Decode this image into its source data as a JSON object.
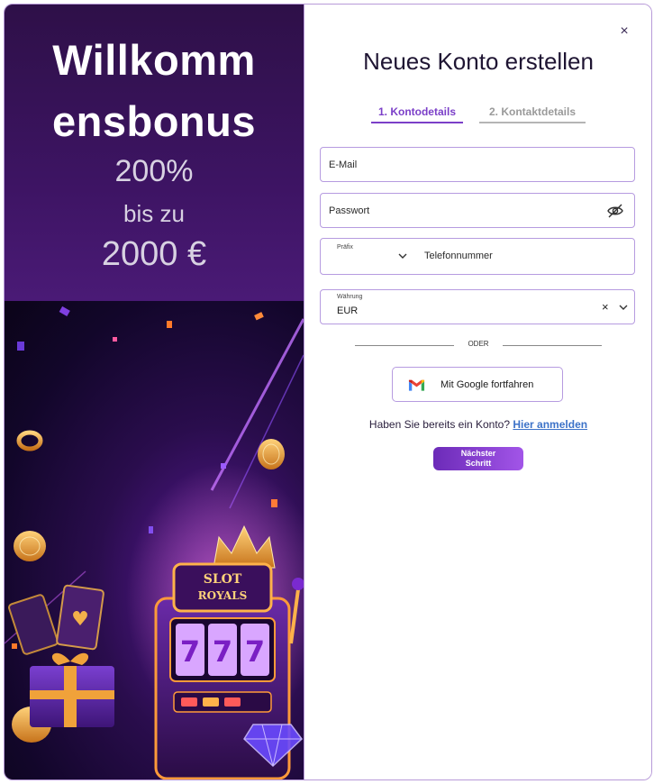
{
  "promo": {
    "headline_line1": "Willkomm",
    "headline_line2": "ensbonus",
    "percent": "200%",
    "bis_zu": "bis zu",
    "amount": "2000 €"
  },
  "slot_sign": {
    "line1": "SLOT",
    "line2": "ROYALS",
    "reels": [
      "7",
      "7",
      "7"
    ]
  },
  "modal": {
    "close": "×",
    "title": "Neues Konto erstellen",
    "tabs": [
      "1. Kontodetails",
      "2. Kontaktdetails"
    ],
    "email_placeholder": "E-Mail",
    "password_placeholder": "Passwort",
    "phone": {
      "prefix_label": "Präfix",
      "placeholder": "Telefonnummer"
    },
    "currency": {
      "label": "Währung",
      "value": "EUR",
      "clear": "×"
    },
    "or_label": "ODER",
    "google_button": "Mit Google fortfahren",
    "login_prompt": "Haben Sie bereits ein Konto?",
    "login_link": "Hier anmelden",
    "next_line1": "Nächster",
    "next_line2": "Schritt"
  },
  "colors": {
    "accent": "#7b3fc8",
    "border": "#b69be0",
    "link": "#3c72c8",
    "promo_bg": "#3d1463"
  },
  "icons": [
    "close-icon",
    "eye-slash-icon",
    "chevron-down-icon",
    "google-g-icon"
  ]
}
